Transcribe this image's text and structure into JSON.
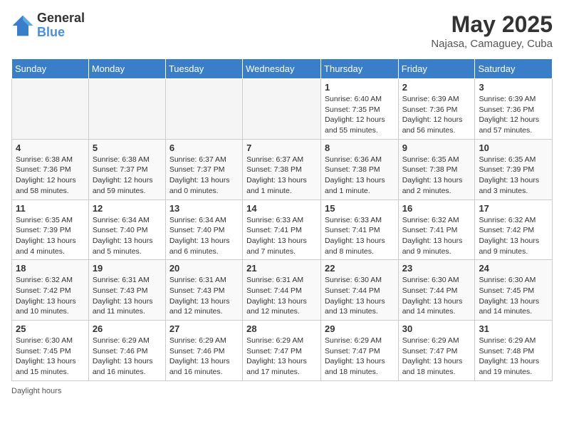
{
  "header": {
    "logo_general": "General",
    "logo_blue": "Blue",
    "month_title": "May 2025",
    "location": "Najasa, Camaguey, Cuba"
  },
  "weekdays": [
    "Sunday",
    "Monday",
    "Tuesday",
    "Wednesday",
    "Thursday",
    "Friday",
    "Saturday"
  ],
  "rows": [
    [
      {
        "day": "",
        "info": ""
      },
      {
        "day": "",
        "info": ""
      },
      {
        "day": "",
        "info": ""
      },
      {
        "day": "",
        "info": ""
      },
      {
        "day": "1",
        "info": "Sunrise: 6:40 AM\nSunset: 7:35 PM\nDaylight: 12 hours and 55 minutes."
      },
      {
        "day": "2",
        "info": "Sunrise: 6:39 AM\nSunset: 7:36 PM\nDaylight: 12 hours and 56 minutes."
      },
      {
        "day": "3",
        "info": "Sunrise: 6:39 AM\nSunset: 7:36 PM\nDaylight: 12 hours and 57 minutes."
      }
    ],
    [
      {
        "day": "4",
        "info": "Sunrise: 6:38 AM\nSunset: 7:36 PM\nDaylight: 12 hours and 58 minutes."
      },
      {
        "day": "5",
        "info": "Sunrise: 6:38 AM\nSunset: 7:37 PM\nDaylight: 12 hours and 59 minutes."
      },
      {
        "day": "6",
        "info": "Sunrise: 6:37 AM\nSunset: 7:37 PM\nDaylight: 13 hours and 0 minutes."
      },
      {
        "day": "7",
        "info": "Sunrise: 6:37 AM\nSunset: 7:38 PM\nDaylight: 13 hours and 1 minute."
      },
      {
        "day": "8",
        "info": "Sunrise: 6:36 AM\nSunset: 7:38 PM\nDaylight: 13 hours and 1 minute."
      },
      {
        "day": "9",
        "info": "Sunrise: 6:35 AM\nSunset: 7:38 PM\nDaylight: 13 hours and 2 minutes."
      },
      {
        "day": "10",
        "info": "Sunrise: 6:35 AM\nSunset: 7:39 PM\nDaylight: 13 hours and 3 minutes."
      }
    ],
    [
      {
        "day": "11",
        "info": "Sunrise: 6:35 AM\nSunset: 7:39 PM\nDaylight: 13 hours and 4 minutes."
      },
      {
        "day": "12",
        "info": "Sunrise: 6:34 AM\nSunset: 7:40 PM\nDaylight: 13 hours and 5 minutes."
      },
      {
        "day": "13",
        "info": "Sunrise: 6:34 AM\nSunset: 7:40 PM\nDaylight: 13 hours and 6 minutes."
      },
      {
        "day": "14",
        "info": "Sunrise: 6:33 AM\nSunset: 7:41 PM\nDaylight: 13 hours and 7 minutes."
      },
      {
        "day": "15",
        "info": "Sunrise: 6:33 AM\nSunset: 7:41 PM\nDaylight: 13 hours and 8 minutes."
      },
      {
        "day": "16",
        "info": "Sunrise: 6:32 AM\nSunset: 7:41 PM\nDaylight: 13 hours and 9 minutes."
      },
      {
        "day": "17",
        "info": "Sunrise: 6:32 AM\nSunset: 7:42 PM\nDaylight: 13 hours and 9 minutes."
      }
    ],
    [
      {
        "day": "18",
        "info": "Sunrise: 6:32 AM\nSunset: 7:42 PM\nDaylight: 13 hours and 10 minutes."
      },
      {
        "day": "19",
        "info": "Sunrise: 6:31 AM\nSunset: 7:43 PM\nDaylight: 13 hours and 11 minutes."
      },
      {
        "day": "20",
        "info": "Sunrise: 6:31 AM\nSunset: 7:43 PM\nDaylight: 13 hours and 12 minutes."
      },
      {
        "day": "21",
        "info": "Sunrise: 6:31 AM\nSunset: 7:44 PM\nDaylight: 13 hours and 12 minutes."
      },
      {
        "day": "22",
        "info": "Sunrise: 6:30 AM\nSunset: 7:44 PM\nDaylight: 13 hours and 13 minutes."
      },
      {
        "day": "23",
        "info": "Sunrise: 6:30 AM\nSunset: 7:44 PM\nDaylight: 13 hours and 14 minutes."
      },
      {
        "day": "24",
        "info": "Sunrise: 6:30 AM\nSunset: 7:45 PM\nDaylight: 13 hours and 14 minutes."
      }
    ],
    [
      {
        "day": "25",
        "info": "Sunrise: 6:30 AM\nSunset: 7:45 PM\nDaylight: 13 hours and 15 minutes."
      },
      {
        "day": "26",
        "info": "Sunrise: 6:29 AM\nSunset: 7:46 PM\nDaylight: 13 hours and 16 minutes."
      },
      {
        "day": "27",
        "info": "Sunrise: 6:29 AM\nSunset: 7:46 PM\nDaylight: 13 hours and 16 minutes."
      },
      {
        "day": "28",
        "info": "Sunrise: 6:29 AM\nSunset: 7:47 PM\nDaylight: 13 hours and 17 minutes."
      },
      {
        "day": "29",
        "info": "Sunrise: 6:29 AM\nSunset: 7:47 PM\nDaylight: 13 hours and 18 minutes."
      },
      {
        "day": "30",
        "info": "Sunrise: 6:29 AM\nSunset: 7:47 PM\nDaylight: 13 hours and 18 minutes."
      },
      {
        "day": "31",
        "info": "Sunrise: 6:29 AM\nSunset: 7:48 PM\nDaylight: 13 hours and 19 minutes."
      }
    ]
  ],
  "footer": {
    "daylight_hours_label": "Daylight hours"
  }
}
